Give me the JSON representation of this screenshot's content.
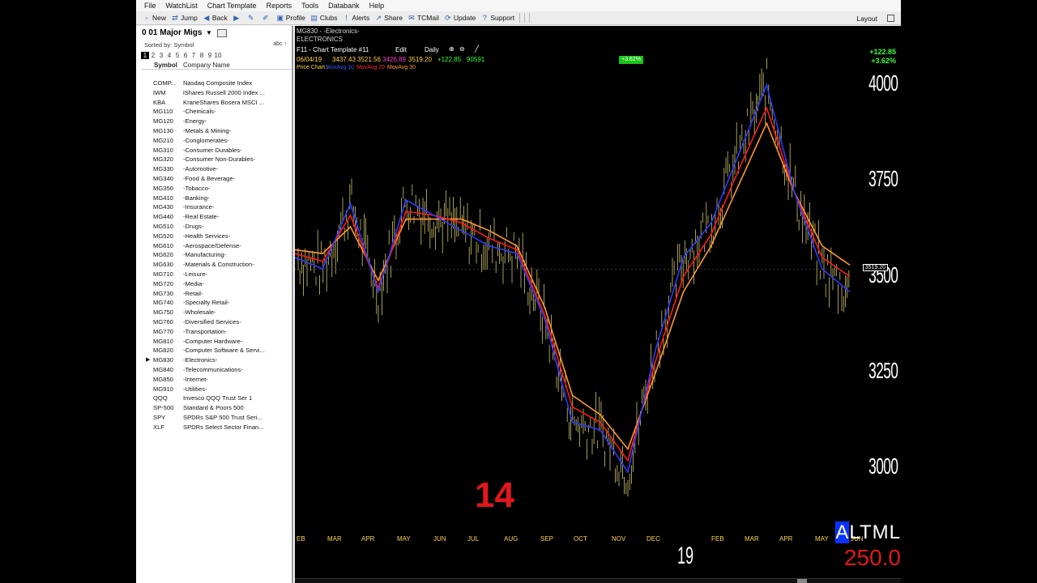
{
  "menu": [
    "File",
    "WatchList",
    "Chart Template",
    "Reports",
    "Tools",
    "Databank",
    "Help"
  ],
  "toolbar": {
    "items": [
      {
        "icon": "new-icon",
        "glyph": "▫",
        "label": "New"
      },
      {
        "icon": "jump-icon",
        "glyph": "⇄",
        "label": "Jump"
      },
      {
        "icon": "back-icon",
        "glyph": "◀",
        "label": "Back"
      },
      {
        "icon": "forward-icon",
        "glyph": "▶",
        "label": ""
      },
      {
        "icon": "draw-icon",
        "glyph": "✎",
        "label": ""
      },
      {
        "icon": "pen-icon",
        "glyph": "✐",
        "label": ""
      },
      {
        "icon": "profile-icon",
        "glyph": "▣",
        "label": "Profile"
      },
      {
        "icon": "clubs-icon",
        "glyph": "▤",
        "label": "Clubs"
      },
      {
        "icon": "alerts-icon",
        "glyph": "!",
        "label": "Alerts"
      },
      {
        "icon": "share-icon",
        "glyph": "↗",
        "label": "Share"
      },
      {
        "icon": "tcmail-icon",
        "glyph": "✉",
        "label": "TCMail"
      },
      {
        "icon": "update-icon",
        "glyph": "⟳",
        "label": "Update"
      },
      {
        "icon": "support-icon",
        "glyph": "?",
        "label": "Support"
      }
    ],
    "layout_label": "Layout"
  },
  "watchlist": {
    "title": "0 01 Major Migs",
    "sorted_by": "Sorted by: Symbol",
    "abc": "abc ↑",
    "pages": [
      "1",
      "2",
      "3",
      "4",
      "5",
      "6",
      "7",
      "8",
      "9",
      "10"
    ],
    "col_symbol": "Symbol",
    "col_company": "Company Name",
    "selected_index": 29,
    "rows": [
      {
        "sym": "COMP...",
        "co": "Nasdaq Composite Index"
      },
      {
        "sym": "IWM",
        "co": "iShares Russell 2000 Index ..."
      },
      {
        "sym": "KBA",
        "co": "KraneShares Bosera MSCI ..."
      },
      {
        "sym": "MG110",
        "co": "-Chemicals-"
      },
      {
        "sym": "MG120",
        "co": "-Energy-"
      },
      {
        "sym": "MG130",
        "co": "-Metals & Mining-"
      },
      {
        "sym": "MG210",
        "co": "-Conglomerates-"
      },
      {
        "sym": "MG310",
        "co": "-Consumer Durables-"
      },
      {
        "sym": "MG320",
        "co": "-Consumer Non-Durables-"
      },
      {
        "sym": "MG330",
        "co": "-Automotive-"
      },
      {
        "sym": "MG340",
        "co": "-Food & Beverage-"
      },
      {
        "sym": "MG350",
        "co": "-Tobacco-"
      },
      {
        "sym": "MG410",
        "co": "-Banking-"
      },
      {
        "sym": "MG430",
        "co": "-Insurance-"
      },
      {
        "sym": "MG440",
        "co": "-Real Estate-"
      },
      {
        "sym": "MG510",
        "co": "-Drugs-"
      },
      {
        "sym": "MG520",
        "co": "-Health Services-"
      },
      {
        "sym": "MG610",
        "co": "-Aerospace/Defense-"
      },
      {
        "sym": "MG620",
        "co": "-Manufacturing-"
      },
      {
        "sym": "MG630",
        "co": "-Materials & Construction-"
      },
      {
        "sym": "MG710",
        "co": "-Leisure-"
      },
      {
        "sym": "MG720",
        "co": "-Media-"
      },
      {
        "sym": "MG730",
        "co": "-Retail-"
      },
      {
        "sym": "MG740",
        "co": "-Specialty Retail-"
      },
      {
        "sym": "MG750",
        "co": "-Wholesale-"
      },
      {
        "sym": "MG760",
        "co": "-Diversified Services-"
      },
      {
        "sym": "MG770",
        "co": "-Transportation-"
      },
      {
        "sym": "MG810",
        "co": "-Computer Hardware-"
      },
      {
        "sym": "MG820",
        "co": "-Computer Software & Servi..."
      },
      {
        "sym": "MG830",
        "co": "-Electronics-"
      },
      {
        "sym": "MG840",
        "co": "-Telecommunications-"
      },
      {
        "sym": "MG850",
        "co": "-Internet-"
      },
      {
        "sym": "MG910",
        "co": "-Utilities-"
      },
      {
        "sym": "QQQ",
        "co": "Invesco QQQ Trust Ser 1"
      },
      {
        "sym": "SP-500",
        "co": "Standard & Poors 500"
      },
      {
        "sym": "SPY",
        "co": "SPDRs S&P 500 Trust Seri..."
      },
      {
        "sym": "XLF",
        "co": "SPDRs Select Sector Finan..."
      }
    ]
  },
  "chart": {
    "symbol": "MG830 - -Electronics-",
    "name": "ELECTRONICS",
    "template": "F11 - Chart Template #11",
    "edit_label": "Edit",
    "period": "Daily",
    "date": "06/04/19",
    "open": "3437.43",
    "high": "3521.56",
    "low": "3426.89",
    "close": "3519.20",
    "change": "+122.85",
    "volume": "90591",
    "price_chart_label": "Price Chart :",
    "ma1_label": "MovAvg 10",
    "ma2_label": "MovAvg 20",
    "ma3_label": "MovAvg 30",
    "badge": "+3.62%",
    "change_abs": "+122.85",
    "change_pct": "+3.62%",
    "current_price_label": "3519.20",
    "year_label": "19",
    "y_ticks": [
      {
        "label": "4000",
        "value": 4000
      },
      {
        "label": "3750",
        "value": 3750
      },
      {
        "label": "3500",
        "value": 3500
      },
      {
        "label": "3250",
        "value": 3250
      },
      {
        "label": "3000",
        "value": 3000
      }
    ],
    "x_ticks": [
      "EB",
      "MAR",
      "APR",
      "MAY",
      "JUN",
      "JUL",
      "AUG",
      "SEP",
      "OCT",
      "NOV",
      "DEC",
      "FEB",
      "MAR",
      "APR",
      "MAY",
      "JUN"
    ],
    "colors": {
      "bars": "#cfc56a",
      "ma1": "#2b3bff",
      "ma2": "#ff1a1a",
      "ma3": "#ff9a2b"
    }
  },
  "overlay": {
    "counter": "14",
    "altml_hl": "A",
    "altml_rest": "LTML",
    "bignum": "250.0"
  },
  "chart_data": {
    "type": "line",
    "ylim": [
      2840,
      4080
    ],
    "series": [
      {
        "name": "MovAvg 10",
        "x": [
          0,
          5,
          10,
          15,
          20,
          25,
          30,
          35,
          40,
          45,
          50,
          55,
          60,
          65,
          70,
          75,
          80,
          85,
          90,
          95,
          100
        ],
        "values": [
          3550,
          3520,
          3690,
          3460,
          3700,
          3660,
          3620,
          3580,
          3560,
          3390,
          3120,
          3100,
          2990,
          3310,
          3550,
          3640,
          3820,
          4000,
          3720,
          3520,
          3460
        ]
      },
      {
        "name": "MovAvg 20",
        "x": [
          0,
          5,
          10,
          15,
          20,
          25,
          30,
          35,
          40,
          45,
          50,
          55,
          60,
          65,
          70,
          75,
          80,
          85,
          90,
          95,
          100
        ],
        "values": [
          3560,
          3540,
          3660,
          3470,
          3670,
          3660,
          3640,
          3600,
          3570,
          3400,
          3160,
          3120,
          3020,
          3280,
          3500,
          3610,
          3780,
          3940,
          3720,
          3550,
          3500
        ]
      },
      {
        "name": "MovAvg 30",
        "x": [
          0,
          5,
          10,
          15,
          20,
          25,
          30,
          35,
          40,
          45,
          50,
          55,
          60,
          65,
          70,
          75,
          80,
          85,
          90,
          95,
          100
        ],
        "values": [
          3570,
          3560,
          3630,
          3490,
          3650,
          3650,
          3650,
          3620,
          3580,
          3420,
          3190,
          3140,
          3050,
          3250,
          3460,
          3580,
          3740,
          3900,
          3720,
          3580,
          3530
        ]
      }
    ]
  }
}
